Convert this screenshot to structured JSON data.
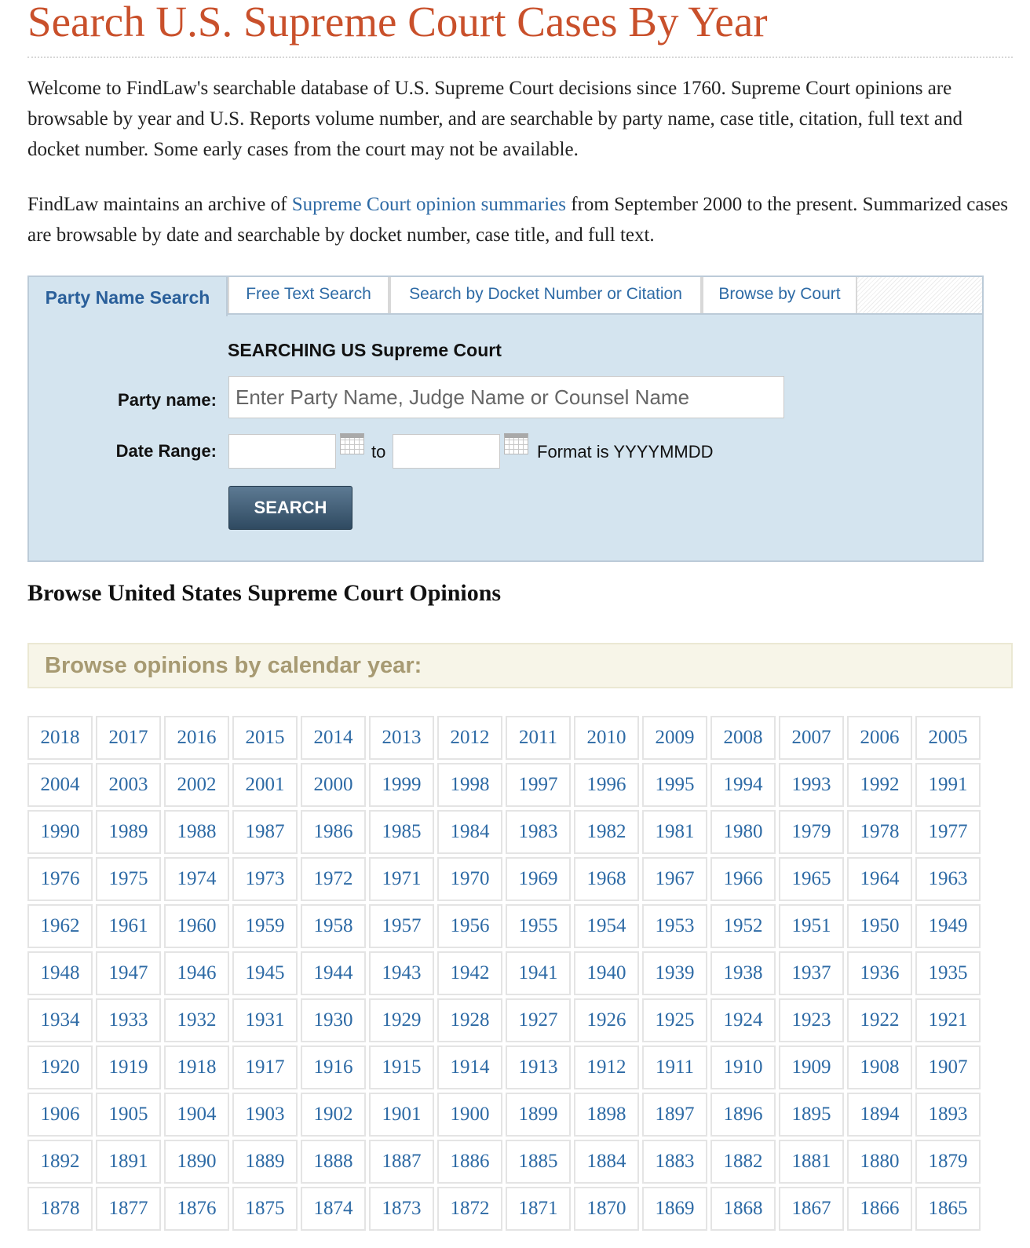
{
  "page": {
    "title": "Search U.S. Supreme Court Cases By Year",
    "intro_1": "Welcome to FindLaw's searchable database of U.S. Supreme Court decisions since 1760. Supreme Court opinions are browsable by year and U.S. Reports volume number, and are searchable by party name, case title, citation, full text and docket number. Some early cases from the court may not be available.",
    "intro_2_before": "FindLaw maintains an archive of ",
    "intro_2_link": "Supreme Court opinion summaries",
    "intro_2_after": " from September 2000 to the present. Summarized cases are browsable by date and searchable by docket number, case title, and full text."
  },
  "search": {
    "tabs": [
      "Party Name Search",
      "Free Text Search",
      "Search by Docket Number or Citation",
      "Browse by Court"
    ],
    "heading": "SEARCHING US Supreme Court",
    "party_label": "Party name:",
    "party_placeholder": "Enter Party Name, Judge Name or Counsel Name",
    "date_label": "Date Range:",
    "date_from": "",
    "date_to": "",
    "to_text": "to",
    "format_text": "Format is YYYYMMDD",
    "button": "SEARCH"
  },
  "browse": {
    "heading": "Browse United States Supreme Court Opinions",
    "year_header": "Browse opinions by calendar year:",
    "years": [
      "2018",
      "2017",
      "2016",
      "2015",
      "2014",
      "2013",
      "2012",
      "2011",
      "2010",
      "2009",
      "2008",
      "2007",
      "2006",
      "2005",
      "2004",
      "2003",
      "2002",
      "2001",
      "2000",
      "1999",
      "1998",
      "1997",
      "1996",
      "1995",
      "1994",
      "1993",
      "1992",
      "1991",
      "1990",
      "1989",
      "1988",
      "1987",
      "1986",
      "1985",
      "1984",
      "1983",
      "1982",
      "1981",
      "1980",
      "1979",
      "1978",
      "1977",
      "1976",
      "1975",
      "1974",
      "1973",
      "1972",
      "1971",
      "1970",
      "1969",
      "1968",
      "1967",
      "1966",
      "1965",
      "1964",
      "1963",
      "1962",
      "1961",
      "1960",
      "1959",
      "1958",
      "1957",
      "1956",
      "1955",
      "1954",
      "1953",
      "1952",
      "1951",
      "1950",
      "1949",
      "1948",
      "1947",
      "1946",
      "1945",
      "1944",
      "1943",
      "1942",
      "1941",
      "1940",
      "1939",
      "1938",
      "1937",
      "1936",
      "1935",
      "1934",
      "1933",
      "1932",
      "1931",
      "1930",
      "1929",
      "1928",
      "1927",
      "1926",
      "1925",
      "1924",
      "1923",
      "1922",
      "1921",
      "1920",
      "1919",
      "1918",
      "1917",
      "1916",
      "1915",
      "1914",
      "1913",
      "1912",
      "1911",
      "1910",
      "1909",
      "1908",
      "1907",
      "1906",
      "1905",
      "1904",
      "1903",
      "1902",
      "1901",
      "1900",
      "1899",
      "1898",
      "1897",
      "1896",
      "1895",
      "1894",
      "1893",
      "1892",
      "1891",
      "1890",
      "1889",
      "1888",
      "1887",
      "1886",
      "1885",
      "1884",
      "1883",
      "1882",
      "1881",
      "1880",
      "1879",
      "1878",
      "1877",
      "1876",
      "1875",
      "1874",
      "1873",
      "1872",
      "1871",
      "1870",
      "1869",
      "1868",
      "1867",
      "1866",
      "1865"
    ]
  },
  "colors": {
    "title": "#c9502b",
    "link": "#2d6aa5",
    "panel_bg": "#d4e4ef",
    "year_header_text": "#a79a72"
  }
}
